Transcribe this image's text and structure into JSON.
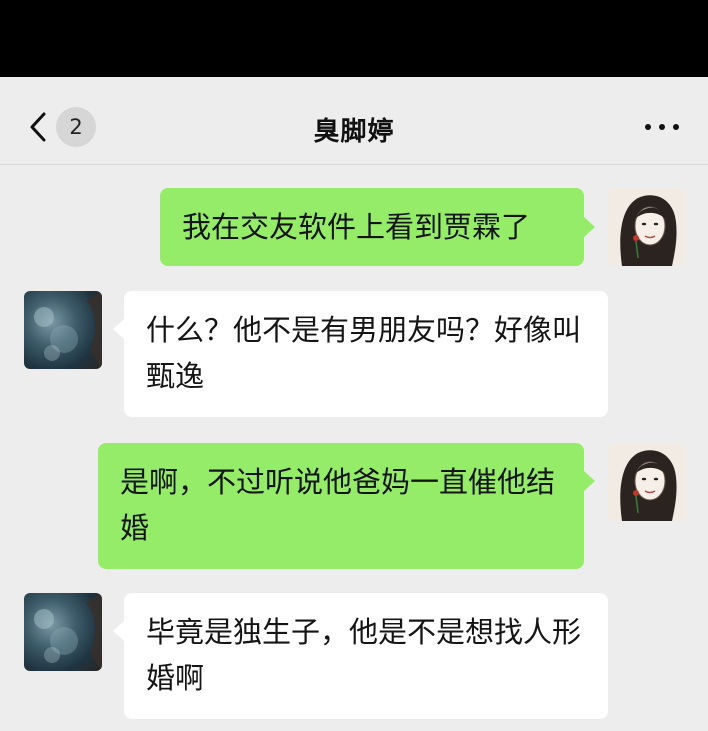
{
  "header": {
    "unread_count": "2",
    "title": "臭脚婷",
    "icons": {
      "back": "chevron-left-icon",
      "more": "more-dots-icon"
    }
  },
  "colors": {
    "sent_bubble": "#95ec69",
    "received_bubble": "#ffffff",
    "background": "#ededed"
  },
  "messages": [
    {
      "sender": "me",
      "text": "我在交友软件上看到贾霖了"
    },
    {
      "sender": "other",
      "text": "什么？他不是有男朋友吗？好像叫甄逸"
    },
    {
      "sender": "me",
      "text": "是啊，不过听说他爸妈一直催他结婚"
    },
    {
      "sender": "other",
      "text": "毕竟是独生子，他是不是想找人形婚啊"
    }
  ]
}
